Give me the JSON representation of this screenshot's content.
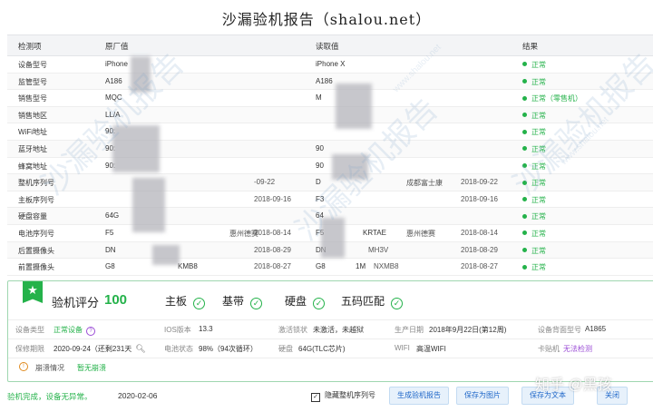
{
  "title": "沙漏验机报告（shalou.net）",
  "table": {
    "headers": {
      "item": "检测项",
      "factory": "原厂值",
      "read": "读取值",
      "result": "结果"
    },
    "rows": [
      {
        "item": "设备型号",
        "factory": "iPhone",
        "factory_date": "",
        "read": "iPhone X",
        "read_extra": "",
        "read_date": "",
        "result": "正常"
      },
      {
        "item": "监管型号",
        "factory": "A186",
        "factory_date": "",
        "read": "A186",
        "read_extra": "",
        "read_date": "",
        "result": "正常"
      },
      {
        "item": "销售型号",
        "factory": "MQC",
        "factory_date": "",
        "read": "M",
        "read_extra": "",
        "read_date": "",
        "result": "正常（零售机）"
      },
      {
        "item": "销售地区",
        "factory": "LL/A",
        "factory_date": "",
        "read": "",
        "read_extra": "",
        "read_date": "",
        "result": "正常"
      },
      {
        "item": "WiFi地址",
        "factory": "90:",
        "factory_date": "",
        "read": "",
        "read_extra": "",
        "read_date": "",
        "result": "正常"
      },
      {
        "item": "蓝牙地址",
        "factory": "90:",
        "factory_date": "",
        "read": "90",
        "read_extra": "",
        "read_date": "",
        "result": "正常"
      },
      {
        "item": "蜂窝地址",
        "factory": "90:",
        "factory_date": "",
        "read": "90",
        "read_extra": "",
        "read_date": "",
        "result": "正常"
      },
      {
        "item": "整机序列号",
        "factory": "",
        "factory_date": "-09-22",
        "read": "D",
        "read_extra": "成都富士康",
        "read_date": "2018-09-22",
        "result": "正常"
      },
      {
        "item": "主板序列号",
        "factory": "",
        "factory_date": "2018-09-16",
        "read": "F3",
        "read_extra": "",
        "read_date": "2018-09-16",
        "result": "正常"
      },
      {
        "item": "硬盘容量",
        "factory": "64G",
        "factory_date": "",
        "read": "64",
        "read_extra": "",
        "read_date": "",
        "result": "正常"
      },
      {
        "item": "电池序列号",
        "factory": "F5",
        "factory_extra": "惠州德赛",
        "factory_date": "2018-08-14",
        "read": "F5",
        "read_extra": "惠州德赛",
        "read_extra_prefix": "KRTAE",
        "read_date": "2018-08-14",
        "result": "正常"
      },
      {
        "item": "后置摄像头",
        "factory": "DN",
        "factory_date": "2018-08-29",
        "read": "DN",
        "read_extra": "MH3V",
        "read_date": "2018-08-29",
        "result": "正常"
      },
      {
        "item": "前置摄像头",
        "factory": "G8",
        "factory_suffix": "KMB8",
        "factory_date": "2018-08-27",
        "read": "G8",
        "read_extra": "NXMB8",
        "read_suffix": "1M",
        "read_date": "2018-08-27",
        "result": "正常"
      }
    ]
  },
  "score": {
    "label": "验机评分",
    "value": "100",
    "checks": [
      "主板",
      "基带",
      "硬盘",
      "五码匹配"
    ]
  },
  "info": {
    "device_type_label": "设备类型",
    "device_type_value": "正常设备",
    "ios_label": "IOS版本",
    "ios_value": "13.3",
    "activation_label": "激活锁状",
    "activation_value": "未激活，未越狱",
    "prod_date_label": "生产日期",
    "prod_date_value": "2018年9月22日(第12周)",
    "back_model_label": "设备背面型号",
    "back_model_value": "A1865",
    "warranty_label": "保修期限",
    "warranty_value": "2020-09-24（还剩231天",
    "battery_label": "电池状态",
    "battery_value": "98%（94次循环）",
    "disk_label": "硬盘",
    "disk_value": "64G(TLC芯片)",
    "wifi_label": "WIFI",
    "wifi_value": "高温WIFI",
    "sim_label": "卡贴机",
    "sim_value": "无法检测",
    "crash_label": "崩溃情况",
    "crash_value": "暂无崩溃"
  },
  "footer": {
    "status": "验机完成，设备无异常。",
    "date": "2020-02-06",
    "hide_serial_label": "隐藏整机序列号",
    "hide_serial_checked": "✓",
    "buttons": [
      "生成验机报告",
      "保存为图片",
      "保存为文本",
      "关闭"
    ]
  },
  "watermark": {
    "text": "沙漏验机报告",
    "url": "www.shalou.net",
    "zhihu": "知乎 @黑孩"
  },
  "colors": {
    "accent": "#24b24a",
    "link": "#1e66c8",
    "warning": "#e08a1e",
    "purple": "#9b4dd6"
  }
}
